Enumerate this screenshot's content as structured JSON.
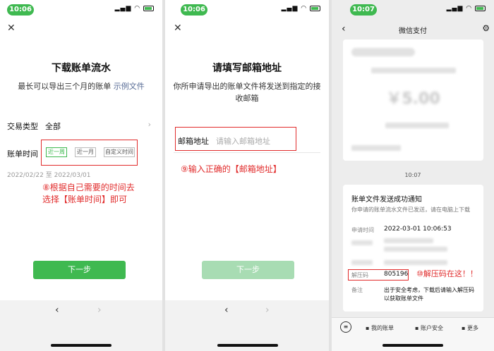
{
  "status_times": [
    "10:06",
    "10:06",
    "10:07"
  ],
  "panel1": {
    "title": "下载账单流水",
    "subtitle": "最长可以导出三个月的账单",
    "example_link": "示例文件",
    "type_label": "交易类型",
    "type_value": "全部",
    "time_label": "账单时间",
    "chips": [
      "近一周",
      "近一月",
      "自定义时间"
    ],
    "date_range": "2022/02/22 至 2022/03/01",
    "annotation": [
      "⑧根据自己需要的时间去",
      "选择【账单时间】即可"
    ],
    "next_button": "下一步"
  },
  "panel2": {
    "title": "请填写邮箱地址",
    "subtitle": [
      "你所申请导出的账单文件将发送到指定的接",
      "收邮箱"
    ],
    "email_label": "邮箱地址",
    "email_placeholder": "请输入邮箱地址",
    "annotation": "⑨输入正确的【邮箱地址】",
    "next_button": "下一步"
  },
  "panel3": {
    "header_title": "微信支付",
    "amount": "￥5.00",
    "chat_time": "10:07",
    "notice_title": "账单文件发送成功通知",
    "notice_desc": "你申请的账单流水文件已发送，请在电脑上下载",
    "apply_time_label": "申请时间",
    "apply_time_value": "2022-03-01 10:06:53",
    "unzip_label": "解压码",
    "unzip_value": "805196",
    "annotation": "⑩解压码在这！！",
    "remark_label": "备注",
    "remark_value": [
      "出于安全考虑，下载后请输入解压码",
      "以获取账单文件"
    ],
    "menu": [
      "我的账单",
      "账户安全",
      "更多"
    ]
  },
  "colors": {
    "accent": "#3fb950",
    "annotation": "#e12b2b",
    "link": "#576b95"
  }
}
